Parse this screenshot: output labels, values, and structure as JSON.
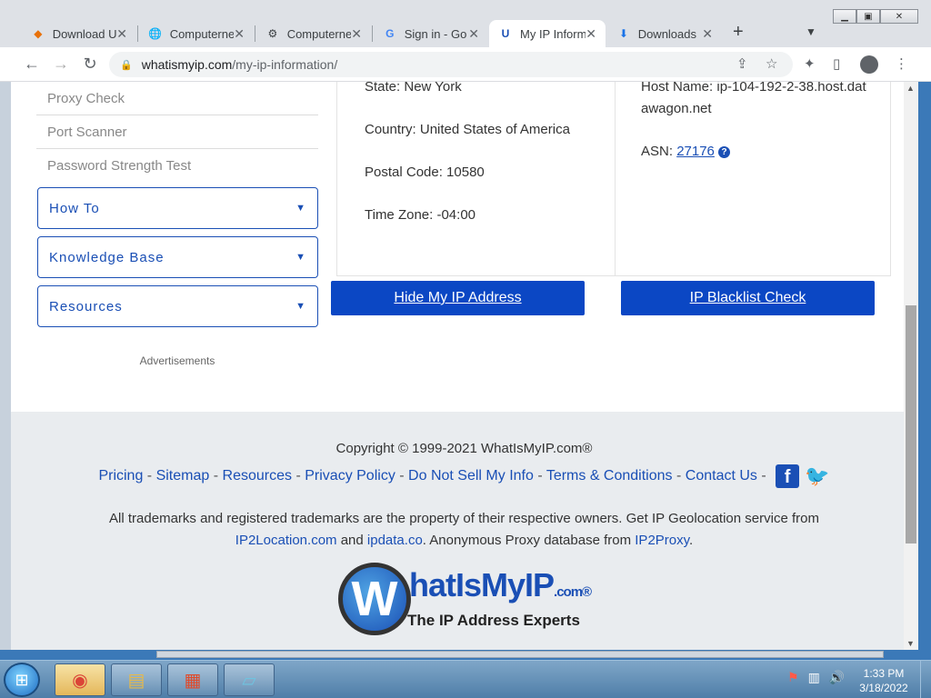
{
  "browser": {
    "tabs": [
      {
        "title": "Download Ul",
        "favicon": "diamond-icon"
      },
      {
        "title": "Computerne",
        "favicon": "globe-icon"
      },
      {
        "title": "Computerne",
        "favicon": "puzzle-icon"
      },
      {
        "title": "Sign in - Go",
        "favicon": "google-icon"
      },
      {
        "title": "My IP Inform",
        "favicon": "whatismyip-icon"
      },
      {
        "title": "Downloads",
        "favicon": "download-icon"
      }
    ],
    "url_host": "whatismyip.com",
    "url_path": "/my-ip-information/"
  },
  "sidebar": {
    "links": [
      "Proxy Check",
      "Port Scanner",
      "Password Strength Test"
    ],
    "dropdowns": [
      "How To",
      "Knowledge Base",
      "Resources"
    ],
    "ads_label": "Advertisements"
  },
  "info": {
    "state": "State: New York",
    "country": "Country: United States of America",
    "postal": "Postal Code: 10580",
    "timezone": "Time Zone: -04:00",
    "hostname": "Host Name: ip-104-192-2-38.host.datawagon.net",
    "asn_label": "ASN:",
    "asn_value": "27176"
  },
  "buttons": {
    "hide_ip": "Hide My IP Address",
    "blacklist": "IP Blacklist Check"
  },
  "footer": {
    "copyright": "Copyright © 1999-2021 WhatIsMyIP.com®",
    "links": [
      "Pricing",
      "Sitemap",
      "Resources",
      "Privacy Policy",
      "Do Not Sell My Info",
      "Terms & Conditions",
      "Contact Us"
    ],
    "legal_pre": "All trademarks and registered trademarks are the property of their respective owners. Get IP Geolocation service from",
    "legal_link1": "IP2Location.com",
    "legal_and": "and",
    "legal_link2": "ipdata.co",
    "legal_mid": ". Anonymous Proxy database from",
    "legal_link3": "IP2Proxy",
    "legal_end": ".",
    "logo_name": "hatIsMyIP",
    "logo_com": ".com®",
    "logo_tagline": "The IP Address Experts"
  },
  "taskbar": {
    "time": "1:33 PM",
    "date": "3/18/2022"
  },
  "colors": {
    "accent_blue": "#0b47c4",
    "link_blue": "#1a4fb5",
    "footer_bg": "#e9ecef"
  }
}
